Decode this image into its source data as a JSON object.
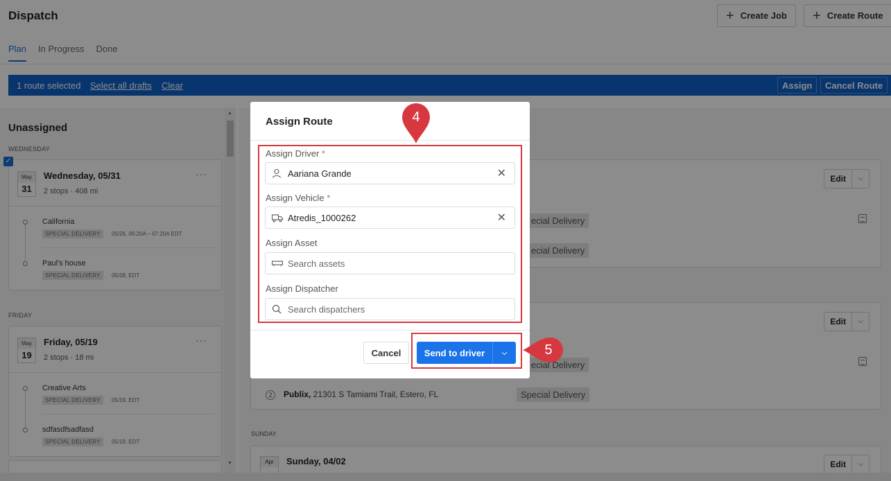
{
  "header": {
    "title": "Dispatch",
    "create_job": "Create Job",
    "create_route": "Create Route",
    "tabs": [
      "Plan",
      "In Progress",
      "Done"
    ]
  },
  "selection_bar": {
    "count": "1 route selected",
    "select_all": "Select all drafts",
    "clear": "Clear",
    "assign": "Assign",
    "cancel_route": "Cancel Route"
  },
  "left_panel": {
    "title": "Unassigned",
    "groups": [
      {
        "day": "WEDNESDAY",
        "month": "May",
        "date": "31",
        "title": "Wednesday, 05/31",
        "stops": "2 stops",
        "distance": "408 mi",
        "items": [
          {
            "name": "California",
            "badge": "SPECIAL DELIVERY",
            "time": "05/26, 06:20A – 07:20A EDT"
          },
          {
            "name": "Paul's house",
            "badge": "SPECIAL DELIVERY",
            "time": "05/28, EDT"
          }
        ]
      },
      {
        "day": "FRIDAY",
        "month": "May",
        "date": "19",
        "title": "Friday, 05/19",
        "stops": "2 stops",
        "distance": "18 mi",
        "items": [
          {
            "name": "Creative Arts",
            "badge": "SPECIAL DELIVERY",
            "time": "05/19, EDT"
          },
          {
            "name": "sdfasdfsadfasd",
            "badge": "SPECIAL DELIVERY",
            "time": "05/19, EDT"
          }
        ]
      }
    ],
    "separator": "·",
    "more": "···"
  },
  "right_panel": {
    "edit": "Edit",
    "special": "Special Delivery",
    "special_cut": "ecial Delivery",
    "publix_name": "Publix,",
    "publix_addr": " 21301 S Tamiami Trail, Estero, FL",
    "publix_num": "2",
    "sunday_day": "SUNDAY",
    "sunday_month": "Apr",
    "sunday_title": "Sunday, 04/02"
  },
  "modal": {
    "title": "Assign Route",
    "driver_label": "Assign Driver",
    "driver_value": "Aariana Grande",
    "vehicle_label": "Assign Vehicle",
    "vehicle_value": "Atredis_1000262",
    "asset_label": "Assign Asset",
    "asset_placeholder": "Search assets",
    "dispatcher_label": "Assign Dispatcher",
    "dispatcher_placeholder": "Search dispatchers",
    "required_mark": "*",
    "cancel": "Cancel",
    "send": "Send to driver"
  },
  "callouts": {
    "step4": "4",
    "step5": "5",
    "color": "#d7373f"
  },
  "colors": {
    "accent": "#1a73e8",
    "selection_bar": "#1061c6"
  }
}
